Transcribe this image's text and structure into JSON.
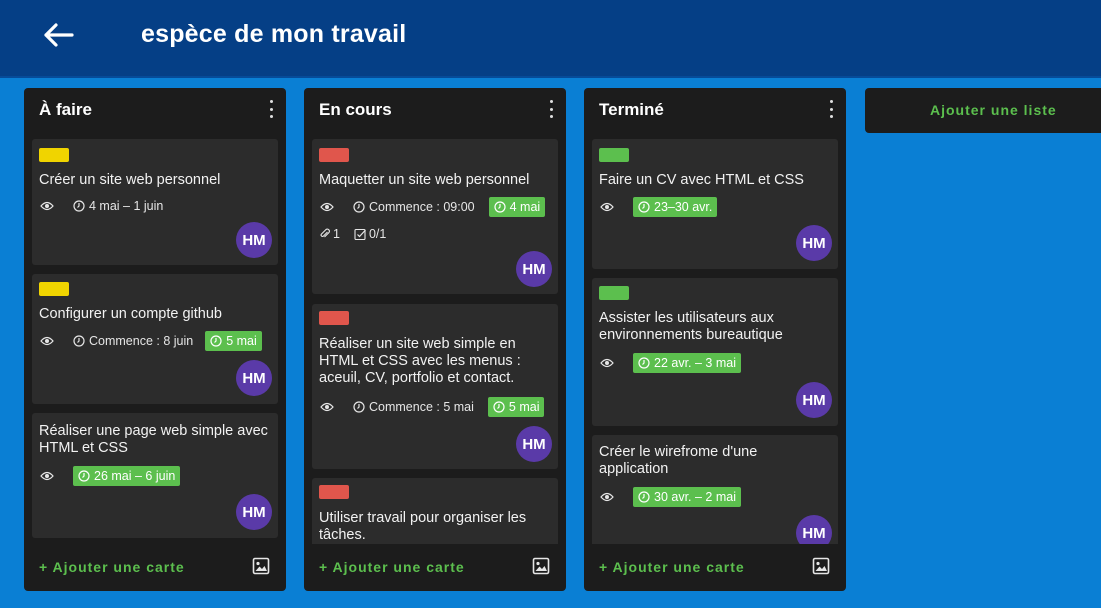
{
  "header": {
    "back_icon": "arrow-left-icon",
    "title": "espèce de mon travail"
  },
  "colors": {
    "header_bg": "#053f86",
    "board_bg": "#0a7fd4",
    "list_bg": "#1c1c1c",
    "card_bg": "#2c2c2c",
    "accent_green": "#5cbf4e",
    "label_yellow": "#f0d400",
    "label_red": "#e0564c",
    "label_green": "#5cbf4e",
    "avatar": "#5a3aa8"
  },
  "lists": [
    {
      "title": "À faire",
      "add_card": "+ Ajouter une carte",
      "cards": [
        {
          "label": "yellow",
          "title": "Créer un site web personnel",
          "date": "4 mai – 1 juin",
          "avatar": "HM"
        },
        {
          "label": "yellow",
          "title": "Configurer un compte github",
          "date": "Commence : 8 juin",
          "due": "5 mai",
          "avatar": "HM"
        },
        {
          "title": "Réaliser une page web simple avec HTML et CSS",
          "due": "26 mai – 6 juin",
          "avatar": "HM"
        }
      ]
    },
    {
      "title": "En cours",
      "add_card": "+ Ajouter une carte",
      "cards": [
        {
          "label": "red",
          "title": "Maquetter un site web personnel",
          "date": "Commence : 09:00",
          "due": "4 mai",
          "attachments": "1",
          "checklist": "0/1",
          "avatar": "HM"
        },
        {
          "label": "red",
          "title": "Réaliser un site web simple en HTML et CSS avec les menus : aceuil, CV, portfolio et contact.",
          "date": "Commence : 5 mai",
          "due": "5 mai",
          "avatar": "HM"
        },
        {
          "label": "red",
          "title": "Utiliser travail pour organiser les tâches."
        }
      ]
    },
    {
      "title": "Terminé",
      "add_card": "+ Ajouter une carte",
      "cards": [
        {
          "label": "green",
          "title": "Faire un CV avec HTML et CSS",
          "due": "23–30 avr.",
          "avatar": "HM"
        },
        {
          "label": "green",
          "title": "Assister les utilisateurs aux environnements bureautique",
          "due": "22 avr. – 3 mai",
          "avatar": "HM"
        },
        {
          "title": "Créer le wirefrome d'une application",
          "due": "30 avr. – 2 mai",
          "avatar": "HM"
        }
      ]
    }
  ],
  "add_list": "Ajouter une liste"
}
